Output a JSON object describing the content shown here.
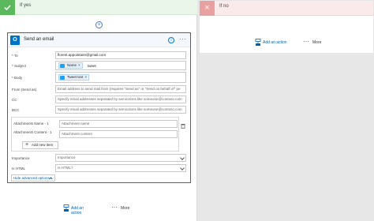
{
  "yes_branch": {
    "title": "If yes"
  },
  "no_branch": {
    "title": "If no",
    "add_action": "Add an action",
    "more": "More"
  },
  "email_card": {
    "title": "Send an email",
    "fields": {
      "to": {
        "label": "* To",
        "value": "florent.appointaire@gmail.com"
      },
      "subject": {
        "label": "* Subject",
        "token": "Name",
        "token_suffix": "tweet"
      },
      "body": {
        "label": "* Body",
        "token": "Tweet text"
      },
      "from": {
        "label": "From (Send as)",
        "placeholder": "Email address to send mail from (requires \"Send as\" or \"Send on behalf of\" pe"
      },
      "cc": {
        "label": "CC",
        "placeholder": "Specify email addresses separated by semicolons like someone@contoso.com"
      },
      "bcc": {
        "label": "BCC",
        "placeholder": "Specify email addresses separated by semicolons like someone@contoso.com"
      },
      "attachments_name": {
        "label": "Attachments Name - 1",
        "placeholder": "Attachment name"
      },
      "attachments_content": {
        "label": "Attachments Content - 1",
        "placeholder": "Attachment content"
      },
      "add_new_item": "Add new item",
      "importance": {
        "label": "Importance",
        "value": "Importance"
      },
      "is_html": {
        "label": "Is HTML",
        "value": "Is HTML?"
      }
    },
    "hide_advanced": "Hide advanced options"
  },
  "yes_footer": {
    "add_action": "Add an action",
    "more": "More"
  }
}
